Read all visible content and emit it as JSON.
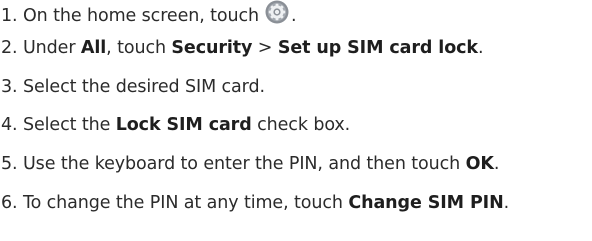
{
  "steps": [
    {
      "number": "1.",
      "pre": "On the home screen, touch",
      "icon": "settings-gear-icon",
      "post": "."
    },
    {
      "number": "2.",
      "t1": "Under ",
      "b1": "All",
      "t2": ", touch ",
      "b2": "Security",
      "t3": " > ",
      "b3": "Set up SIM card lock",
      "t4": "."
    },
    {
      "number": "3.",
      "t1": "Select the desired SIM card."
    },
    {
      "number": "4.",
      "t1": "Select the ",
      "b1": "Lock SIM card",
      "t2": " check box."
    },
    {
      "number": "5.",
      "t1": "Use the keyboard to enter the PIN, and then touch ",
      "b1": "OK",
      "t2": "."
    },
    {
      "number": "6.",
      "t1": "To change the PIN at any time, touch ",
      "b1": "Change SIM PIN",
      "t2": "."
    }
  ],
  "colors": {
    "text": "#2b2b2b",
    "icon_outer": "#8a8f96",
    "icon_inner": "#e9ecef"
  }
}
